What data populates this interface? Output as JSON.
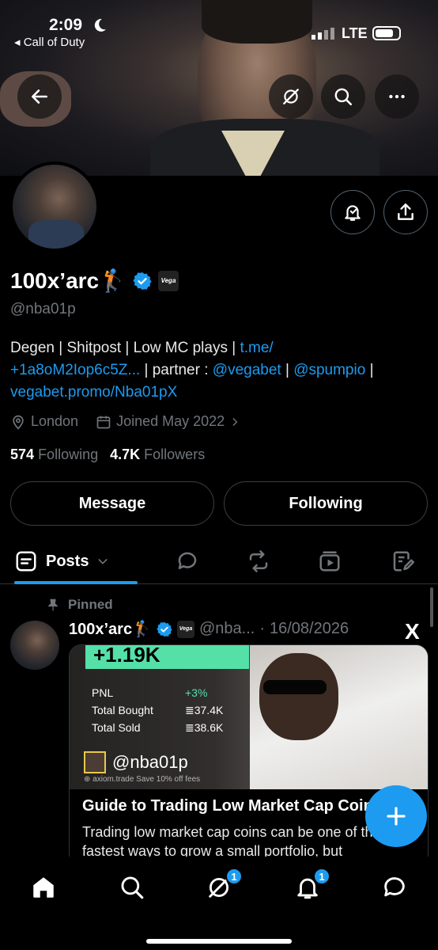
{
  "status_bar": {
    "time": "2:09",
    "back_app": "◂ Call of Duty",
    "network": "LTE"
  },
  "header": {
    "icons": [
      "back-arrow-icon",
      "grok-icon",
      "search-icon",
      "more-icon"
    ]
  },
  "profile": {
    "name": "100x’arc🏌",
    "verified": true,
    "affiliate_badge": "Vega",
    "handle": "@nba01p",
    "bio_text_1": "Degen | Shitpost | Low MC plays | ",
    "bio_link_1": "t.me/",
    "bio_link_1b": "+1a8oM2Iop6c5Z...",
    "bio_text_2": " | partner : ",
    "bio_link_2": "@vegabet",
    "bio_link_3": "@spumpio",
    "bio_text_3": " | ",
    "bio_link_4": "vegabet.promo/Nba01pX",
    "location": "London",
    "joined": "Joined May 2022",
    "following_count": "574",
    "following_label": "Following",
    "followers_count": "4.7K",
    "followers_label": "Followers"
  },
  "actions": {
    "message": "Message",
    "following": "Following"
  },
  "tabs": {
    "posts": "Posts"
  },
  "post": {
    "pinned_label": "Pinned",
    "author": "100x’arc🏌",
    "handle": "@nba...",
    "sep": "·",
    "date": "16/08/2026",
    "card": {
      "gain": "+1.19K",
      "pnl_label": "PNL",
      "pnl_value": "+3%",
      "bought_label": "Total Bought",
      "bought_value": "≣37.4K",
      "sold_label": "Total Sold",
      "sold_value": "≣38.6K",
      "handle": "@nba01p",
      "footer": "⊕ axiom.trade   Save 10% off fees",
      "title": "Guide to Trading Low Market Cap Coins",
      "desc": "Trading low market cap coins can be one of the fastest ways to grow a small portfolio, but"
    }
  },
  "bottom_nav": {
    "grok_badge": "1",
    "notifications_badge": "1"
  },
  "colors": {
    "accent": "#1d9bf0",
    "muted": "#71767b",
    "gain_green": "#55e0a8"
  }
}
